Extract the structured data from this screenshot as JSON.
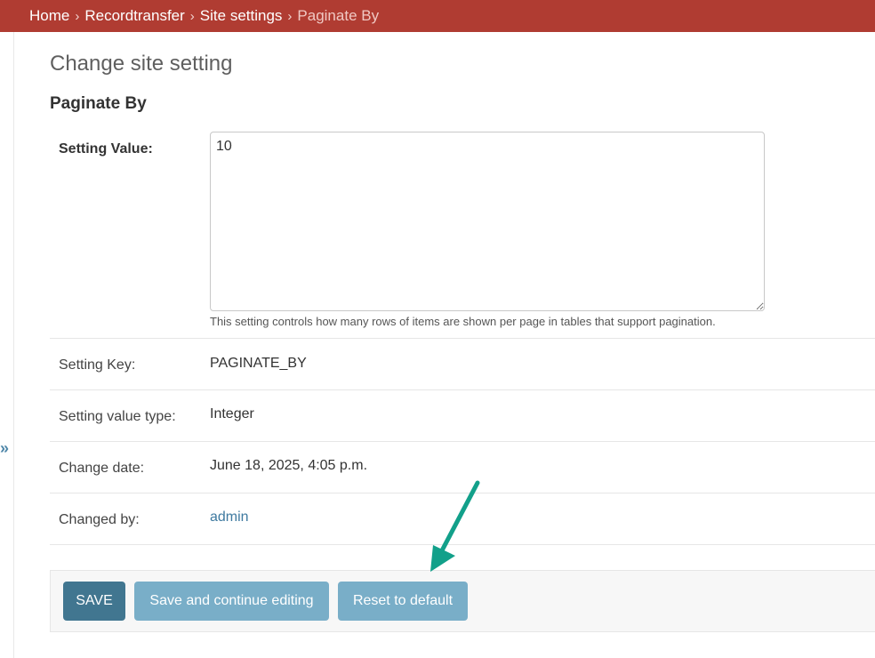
{
  "breadcrumbs": [
    {
      "label": "Home"
    },
    {
      "label": "Recordtransfer"
    },
    {
      "label": "Site settings"
    },
    {
      "label": "Paginate By"
    }
  ],
  "breadcrumb_separator": "›",
  "nav_toggle_glyph": "»",
  "page_title": "Change site setting",
  "object_title": "Paginate By",
  "form": {
    "setting_value": {
      "label": "Setting Value:",
      "value": "10",
      "help": "This setting controls how many rows of items are shown per page in tables that support pagination."
    },
    "setting_key": {
      "label": "Setting Key:",
      "value": "PAGINATE_BY"
    },
    "value_type": {
      "label": "Setting value type:",
      "value": "Integer"
    },
    "change_date": {
      "label": "Change date:",
      "value": "June 18, 2025, 4:05 p.m."
    },
    "changed_by": {
      "label": "Changed by:",
      "value": "admin"
    }
  },
  "buttons": {
    "save": "SAVE",
    "save_continue": "Save and continue editing",
    "reset": "Reset to default"
  },
  "colors": {
    "header_bg": "#b03c32",
    "primary_button": "#417690",
    "secondary_button": "#79aec8",
    "link": "#3f7aa0",
    "annotation_arrow": "#12a08a"
  },
  "icons": {
    "nav_toggle": "double-chevron-right-icon",
    "annotation": "arrow-icon"
  }
}
